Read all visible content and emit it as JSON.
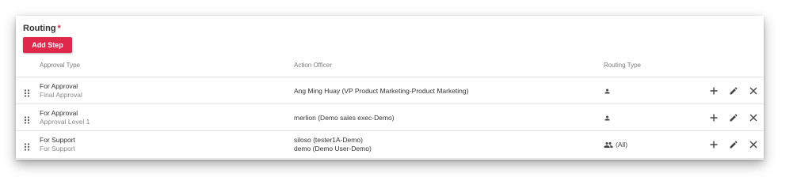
{
  "routing": {
    "title": "Routing",
    "required_mark": "*",
    "add_step_label": "Add Step"
  },
  "columns": {
    "approval_type": "Approval Type",
    "action_officer": "Action Officer",
    "routing_type": "Routing Type"
  },
  "rows": [
    {
      "type": "For Approval",
      "subtype": "Final Approval",
      "officers": [
        "Ang Ming Huay (VP Product Marketing-Product Marketing)"
      ],
      "routing_icon": "person-icon",
      "routing_text": ""
    },
    {
      "type": "For Approval",
      "subtype": "Approval Level 1",
      "officers": [
        "merlion (Demo sales exec-Demo)"
      ],
      "routing_icon": "person-icon",
      "routing_text": ""
    },
    {
      "type": "For Support",
      "subtype": "For Support",
      "officers": [
        "siloso (tester1A-Demo)",
        "demo (Demo User-Demo)"
      ],
      "routing_icon": "group-icon",
      "routing_text": "(All)"
    }
  ],
  "colors": {
    "accent": "#e0284b",
    "icon": "#444444",
    "muted_text": "#8a8a8a"
  }
}
